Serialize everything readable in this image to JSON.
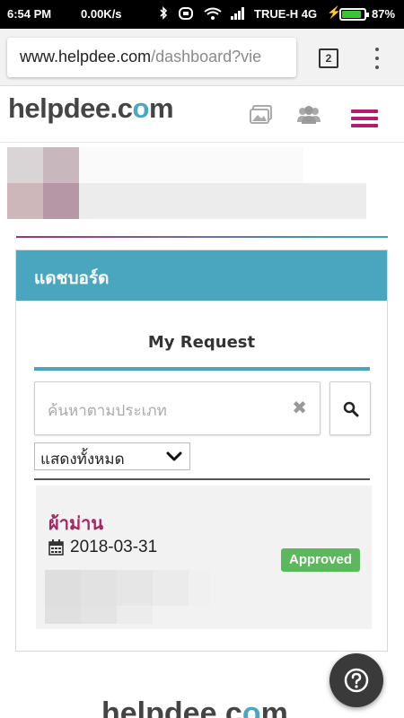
{
  "status_bar": {
    "time": "6:54 PM",
    "network_speed": "0.00K/s",
    "carrier": "TRUE-H 4G",
    "battery_percent": "87%",
    "battery_level": 0.87
  },
  "browser": {
    "url_host": "www.helpdee.com",
    "url_path": "/dashboard?vie",
    "tab_count": "2"
  },
  "site": {
    "logo_text_pre": "helpdee.c",
    "logo_text_o": "o",
    "logo_text_post": "m"
  },
  "dashboard": {
    "title": "แดชบอร์ด",
    "section_title": "My Request",
    "search_placeholder": "ค้นหาตามประเภท",
    "clear_symbol": "✖",
    "filter_selected": "แสดงทั้งหมด"
  },
  "requests": [
    {
      "name": "ผ้าม่าน",
      "date": "2018-03-31",
      "status": "Approved"
    }
  ],
  "colors": {
    "brand_magenta": "#b21c6a",
    "brand_teal": "#4aa5be",
    "status_approved": "#5cb85c"
  },
  "icons": [
    "gallery-icon",
    "users-icon",
    "menu-icon",
    "search-icon",
    "calendar-icon",
    "help-icon",
    "chevron-down-icon"
  ]
}
